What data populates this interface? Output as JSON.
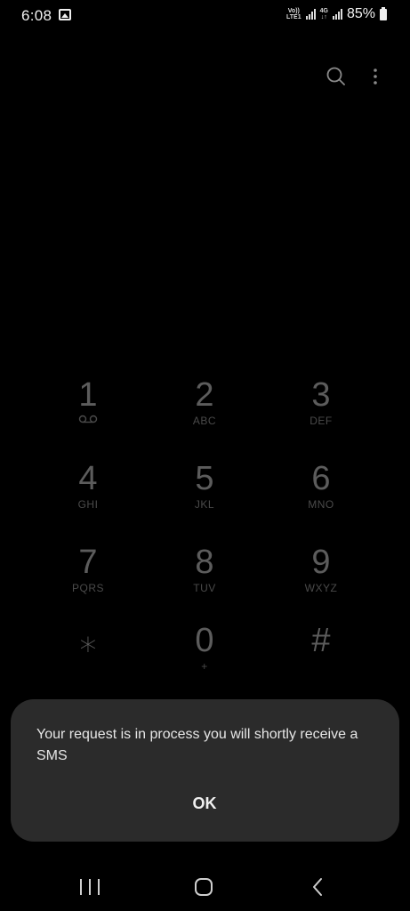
{
  "status_bar": {
    "time": "6:08",
    "volte_top": "Vo))",
    "volte_bottom": "LTE1",
    "network_top": "4G",
    "network_bottom": "↓↑",
    "battery": "85%"
  },
  "icons": {
    "search": "search-icon",
    "more": "more-vert-icon",
    "voicemail": "voicemail-icon",
    "gallery": "gallery-icon",
    "battery": "battery-icon"
  },
  "dialpad": {
    "keys": [
      {
        "digit": "1",
        "letters": ""
      },
      {
        "digit": "2",
        "letters": "ABC"
      },
      {
        "digit": "3",
        "letters": "DEF"
      },
      {
        "digit": "4",
        "letters": "GHI"
      },
      {
        "digit": "5",
        "letters": "JKL"
      },
      {
        "digit": "6",
        "letters": "MNO"
      },
      {
        "digit": "7",
        "letters": "PQRS"
      },
      {
        "digit": "8",
        "letters": "TUV"
      },
      {
        "digit": "9",
        "letters": "WXYZ"
      },
      {
        "digit": "⁎",
        "letters": ""
      },
      {
        "digit": "0",
        "letters": "+"
      },
      {
        "digit": "#",
        "letters": ""
      }
    ]
  },
  "dialog": {
    "message": "Your request is in process you will shortly receive a SMS",
    "ok_label": "OK"
  },
  "colors": {
    "background": "#000000",
    "dialog_background": "#2b2b2b",
    "key_text": "#5c5c5c"
  }
}
